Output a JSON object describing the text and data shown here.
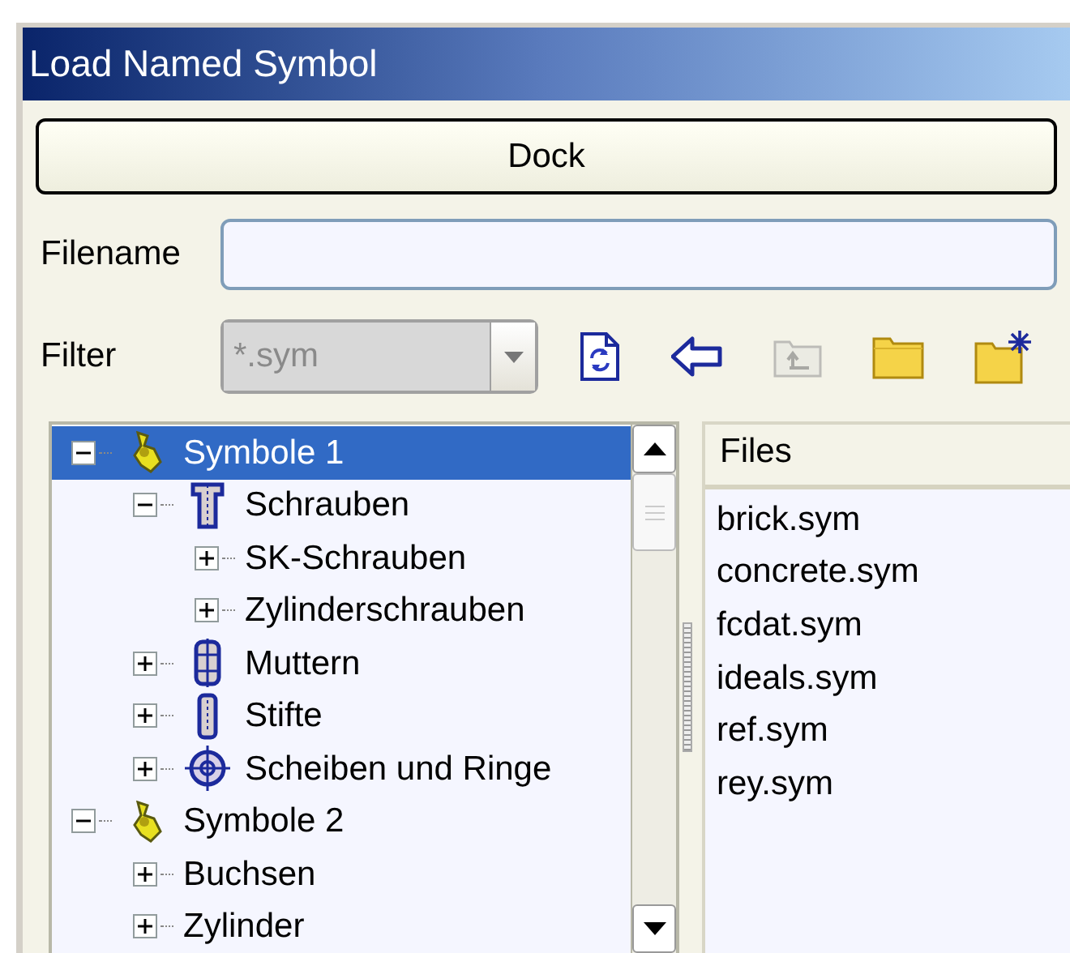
{
  "window": {
    "title": "Load Named Symbol"
  },
  "dock_button": {
    "label": "Dock"
  },
  "filename": {
    "label": "Filename"
  },
  "filter": {
    "label": "Filter",
    "value": "*.sym",
    "disabled": true
  },
  "toolbar": [
    {
      "kind": "refresh",
      "disabled": false
    },
    {
      "kind": "back",
      "disabled": false
    },
    {
      "kind": "up",
      "disabled": true
    },
    {
      "kind": "folder",
      "disabled": false
    },
    {
      "kind": "new-folder",
      "disabled": false
    }
  ],
  "tree": [
    {
      "label": "Symbole 1",
      "kind": "group",
      "expanded": true,
      "selected": true,
      "children": [
        {
          "label": "Schrauben",
          "kind": "screw",
          "expanded": true,
          "selected": false,
          "children": [
            {
              "label": "SK-Schrauben",
              "expanded": false,
              "selected": false
            },
            {
              "label": "Zylinderschrauben",
              "expanded": false,
              "selected": false
            }
          ]
        },
        {
          "label": "Muttern",
          "kind": "nut",
          "expanded": false,
          "selected": false
        },
        {
          "label": "Stifte",
          "kind": "pin",
          "expanded": false,
          "selected": false
        },
        {
          "label": "Scheiben und Ringe",
          "kind": "washer",
          "expanded": false,
          "selected": false
        }
      ]
    },
    {
      "label": "Symbole 2",
      "kind": "group",
      "expanded": true,
      "selected": false,
      "children": [
        {
          "label": "Buchsen",
          "expanded": false,
          "selected": false
        },
        {
          "label": "Zylinder",
          "expanded": false,
          "selected": false
        }
      ]
    }
  ],
  "files": {
    "header": "Files",
    "items": [
      "brick.sym",
      "concrete.sym",
      "fcdat.sym",
      "ideals.sym",
      "ref.sym",
      "rey.sym"
    ]
  }
}
